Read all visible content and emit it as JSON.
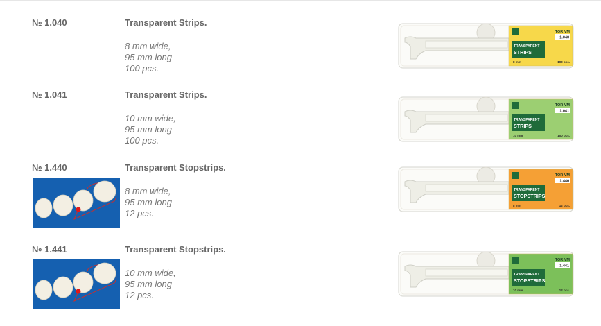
{
  "products": [
    {
      "code": "№ 1.040",
      "title": "Transparent Strips.",
      "specs": [
        "8 mm wide,",
        "95 mm long",
        "100 pcs."
      ],
      "label": {
        "brand": "TOR VM",
        "number": "1.040",
        "line1": "TRANSPARENT",
        "line2": "STRIPS",
        "width": "8 mm",
        "count": "100 pcs.",
        "color": "#f7d84a"
      },
      "has_diagram": false
    },
    {
      "code": "№ 1.041",
      "title": "Transparent Strips.",
      "specs": [
        "10 mm wide,",
        "95 mm long",
        "100 pcs."
      ],
      "label": {
        "brand": "TOR VM",
        "number": "1.041",
        "line1": "TRANSPARENT",
        "line2": "STRIPS",
        "width": "10 mm",
        "count": "100 pcs.",
        "color": "#9ccf72"
      },
      "has_diagram": false
    },
    {
      "code": "№ 1.440",
      "title": "Transparent Stopstrips.",
      "specs": [
        "8 mm wide,",
        "95 mm long",
        "12 pcs."
      ],
      "label": {
        "brand": "TOR VM",
        "number": "1.440",
        "line1": "TRANSPARENT",
        "line2": "STOPSTRIPS",
        "width": "8 mm",
        "count": "12 pcs.",
        "color": "#f5a035"
      },
      "has_diagram": true
    },
    {
      "code": "№ 1.441",
      "title": "Transparent Stopstrips.",
      "specs": [
        "10 mm wide,",
        "95 mm long",
        "12 pcs."
      ],
      "label": {
        "brand": "TOR VM",
        "number": "1.441",
        "line1": "TRANSPARENT",
        "line2": "STOPSTRIPS",
        "width": "10 mm",
        "count": "12 pcs.",
        "color": "#7cc05a"
      },
      "has_diagram": true
    }
  ],
  "colors": {
    "label_green": "#1f6b3a",
    "diagram_blue": "#1560b0",
    "tooth": "#f3efe3",
    "contact_point": "#e01818"
  }
}
